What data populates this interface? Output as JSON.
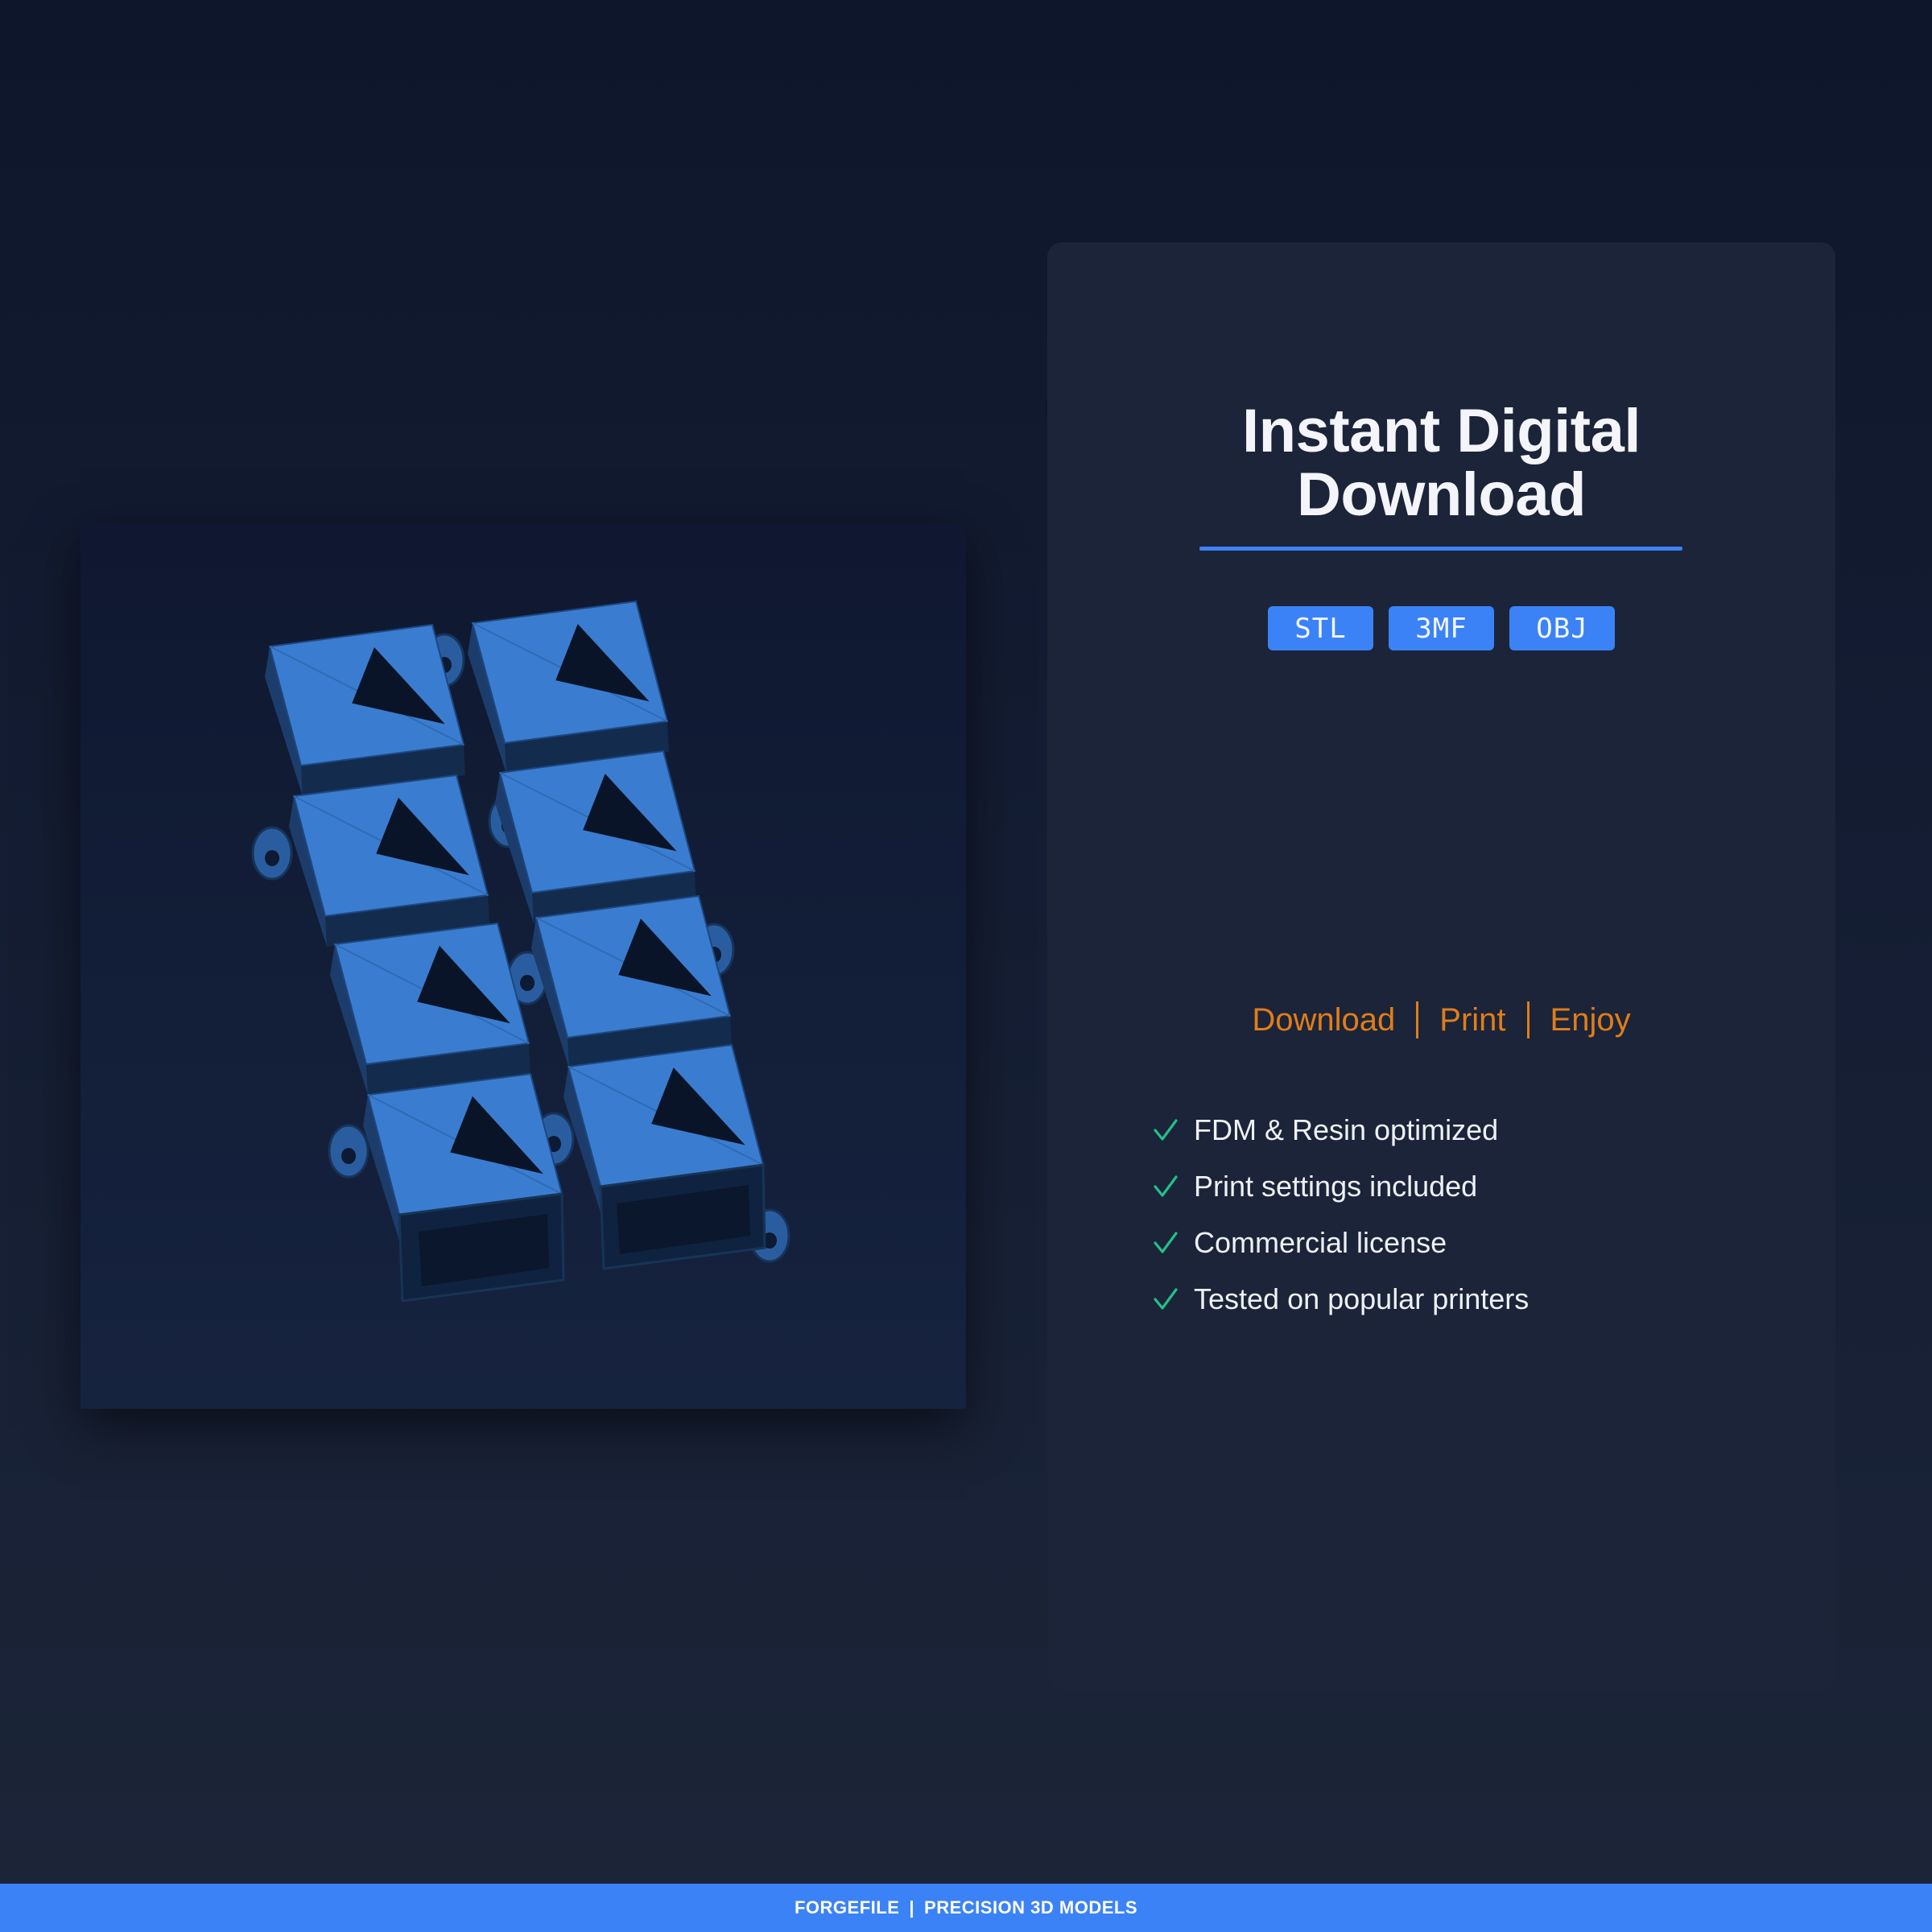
{
  "preview": {
    "image": "3d-model-render",
    "description_icon": "keychain-pendant-grid-icon",
    "model_color": "#3a7dd0"
  },
  "panel": {
    "title_line1": "Instant Digital",
    "title_line2": "Download",
    "formats": [
      "STL",
      "3MF",
      "OBJ"
    ],
    "steps": [
      "Download",
      "Print",
      "Enjoy"
    ],
    "features": [
      "FDM & Resin optimized",
      "Print settings included",
      "Commercial license",
      "Tested on popular printers"
    ]
  },
  "footer": {
    "brand": "FORGEFILE",
    "tagline": "PRECISION 3D MODELS"
  },
  "colors": {
    "accent": "#3b82f6",
    "steps": "#e07d1a",
    "check": "#22c08a",
    "panel_bg": "#1b2438"
  }
}
